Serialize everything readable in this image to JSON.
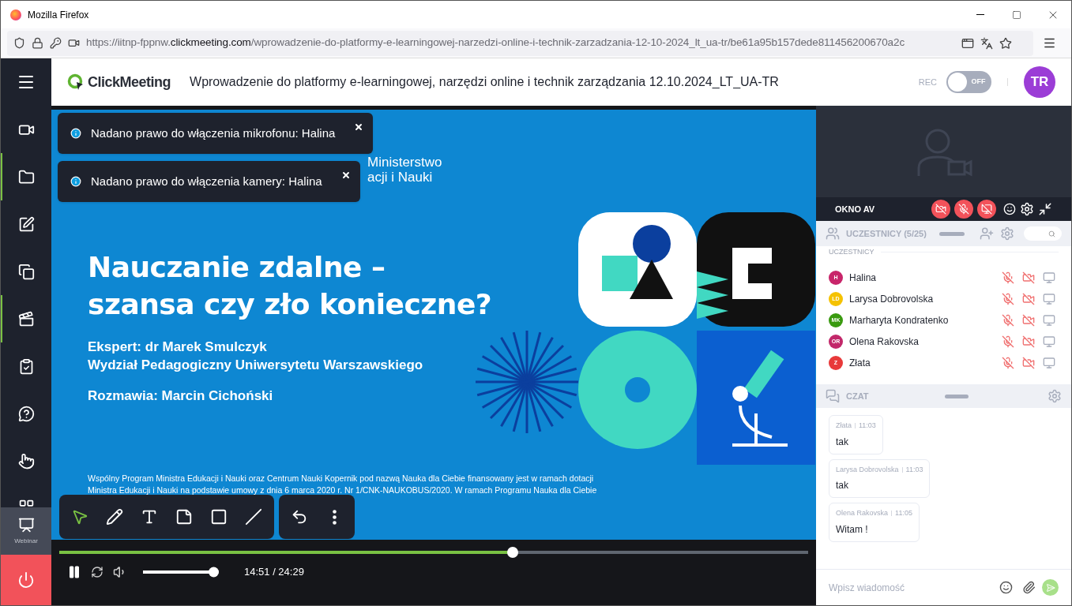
{
  "browser": {
    "title": "Mozilla Firefox",
    "url": {
      "prefix": "https://iitnp-fppnw.",
      "domain": "clickmeeting.com",
      "path": "/wprowadzenie-do-platformy-e-learningowej-narzedzi-online-i-technik-zarzadzania-12-10-2024_lt_ua-tr/be61a95b157dede811456200670a2c"
    }
  },
  "header": {
    "logo": "ClickMeeting",
    "title": "Wprowadzenie do platformy e-learningowej, narzędzi online i technik zarządzania 12.10.2024_LT_UA-TR",
    "rec_label": "REC",
    "rec_toggle": {
      "label": "OFF",
      "on": false
    },
    "avatar": "TR"
  },
  "sidebar": {
    "items": [
      {
        "kind": "video",
        "marked": false,
        "selected": false
      },
      {
        "kind": "folder",
        "marked": true,
        "selected": false
      },
      {
        "kind": "edit",
        "marked": false,
        "selected": false
      },
      {
        "kind": "screens",
        "marked": false,
        "selected": false
      },
      {
        "kind": "media",
        "marked": true,
        "selected": false
      },
      {
        "kind": "test",
        "marked": false,
        "selected": false
      },
      {
        "kind": "question",
        "marked": false,
        "selected": false
      },
      {
        "kind": "hand",
        "marked": false,
        "selected": false
      },
      {
        "kind": "grid",
        "marked": false,
        "selected": false
      },
      {
        "kind": "webinar",
        "label": "Webinar",
        "marked": false,
        "selected": true
      }
    ],
    "leave": {
      "kind": "power"
    }
  },
  "toasts": [
    {
      "text": "Nadano prawo do włączenia mikrofonu: Halina"
    },
    {
      "text": "Nadano prawo do włączenia kamery: Halina"
    }
  ],
  "slide": {
    "ministry_lines": [
      "Ministerstwo",
      "acji i Nauki"
    ],
    "title_lines": [
      "Nauczanie zdalne –",
      "szansa czy zło konieczne?"
    ],
    "expert_lines": [
      "Ekspert: dr Marek Smulczyk",
      "Wydział Pedagogiczny Uniwersytetu Warszawskiego"
    ],
    "host": "Rozmawia: Marcin Cichoński",
    "footnote_lines": [
      "Wspólny Program Ministra Edukacji i Nauki oraz Centrum Nauki Kopernik pod nazwą Nauka dla Ciebie finansowany jest w ramach dotacji",
      "Ministra Edukacji i Nauki na podstawie umowy z dnia 6 marca 2020 r. Nr 1/CNK-NAUKOBUS/2020. W ramach Programu Nauka dla Ciebie"
    ]
  },
  "toolbar": {
    "tools": [
      {
        "kind": "select",
        "selected": true
      },
      {
        "kind": "pen",
        "selected": false
      },
      {
        "kind": "text",
        "selected": false
      },
      {
        "kind": "note",
        "selected": false
      },
      {
        "kind": "rect",
        "selected": false
      },
      {
        "kind": "line",
        "selected": false
      }
    ],
    "actions": [
      {
        "kind": "undo"
      },
      {
        "kind": "more"
      }
    ]
  },
  "player": {
    "playing": true,
    "progress": {
      "level": 0.605
    },
    "volume": {
      "level": 0.93
    },
    "time": "14:51 / 24:29"
  },
  "av": {
    "title": "OKNO AV",
    "camera_on": false,
    "mic_on": false,
    "screen_on": false
  },
  "participants": {
    "title": "UCZESTNICY (5/25)",
    "section": "UCZESTNICY",
    "people": [
      {
        "initials": "H",
        "name": "Halina",
        "color": "#c8256a",
        "mic_on": false,
        "cam_on": false
      },
      {
        "initials": "LD",
        "name": "Larysa Dobrovolska",
        "color": "#f5c200",
        "mic_on": false,
        "cam_on": false
      },
      {
        "initials": "MK",
        "name": "Marharyta Kondratenko",
        "color": "#3a9a10",
        "mic_on": false,
        "cam_on": false
      },
      {
        "initials": "OR",
        "name": "Olena Rakovska",
        "color": "#c2286a",
        "mic_on": false,
        "cam_on": false
      },
      {
        "initials": "Z",
        "name": "Złata",
        "color": "#e8393a",
        "mic_on": false,
        "cam_on": false
      }
    ]
  },
  "chat": {
    "title": "CZAT",
    "messages": [
      {
        "author": "Złata",
        "time": "11:03",
        "text": "tak"
      },
      {
        "author": "Larysa Dobrovolska",
        "time": "11:03",
        "text": "tak"
      },
      {
        "author": "Olena Rakovska",
        "time": "11:05",
        "text": "Witam !"
      }
    ],
    "placeholder": "Wpisz wiadomość"
  }
}
